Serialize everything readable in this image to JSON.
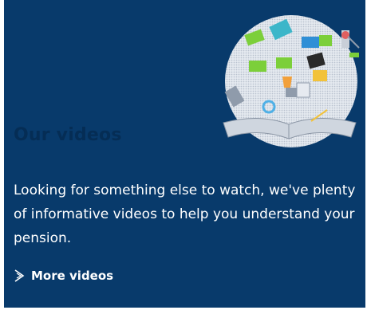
{
  "card": {
    "title": "Our videos",
    "description": "Looking for something else to watch, we've plenty of informative videos to help you understand your pension.",
    "link_label": "More videos",
    "icons": [
      "chevron-right-icon",
      "video-collage-illustration"
    ],
    "colors": {
      "background": "#083a6b",
      "title": "#052d55",
      "text": "#ffffff"
    }
  }
}
